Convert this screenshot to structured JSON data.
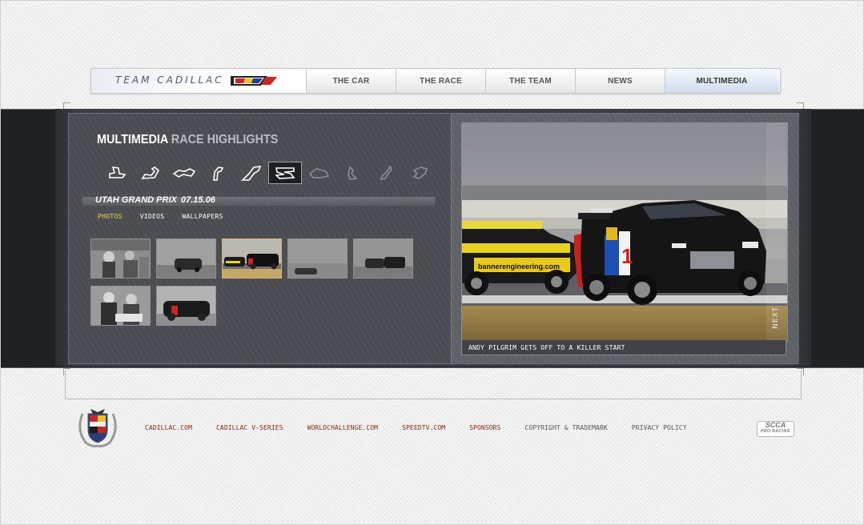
{
  "nav": {
    "brand": "TEAM CADILLAC",
    "brand_logo_icon": "cadillac-crest-icon",
    "items": [
      {
        "label": "THE CAR",
        "active": false
      },
      {
        "label": "THE RACE",
        "active": false
      },
      {
        "label": "THE TEAM",
        "active": false
      },
      {
        "label": "NEWS",
        "active": false
      },
      {
        "label": "MULTIMEDIA",
        "active": true
      }
    ]
  },
  "section": {
    "title": "MULTIMEDIA",
    "subtitle": "RACE HIGHLIGHTS"
  },
  "tracks": {
    "count": 10,
    "selected_index": 5,
    "icon": "race-track-outline-icon"
  },
  "event": {
    "name": "UTAH GRAND PRIX",
    "date": "07.15.06"
  },
  "media_tabs": [
    {
      "label": "PHOTOS",
      "active": true
    },
    {
      "label": "VIDEOS",
      "active": false
    },
    {
      "label": "WALLPAPERS",
      "active": false
    }
  ],
  "thumbnails": {
    "count": 7,
    "selected_index": 2
  },
  "photo": {
    "caption": "ANDY PILGRIM GETS OFF TO A KILLER START",
    "next_label": "NEXT",
    "car_sponsor": "bannerengineering.com",
    "car_number": "1"
  },
  "footer": {
    "links": [
      {
        "label": "CADILLAC.COM",
        "style": "link"
      },
      {
        "label": "CADILLAC V-SERIES",
        "style": "link"
      },
      {
        "label": "WORLDCHALLENGE.COM",
        "style": "link"
      },
      {
        "label": "SPEEDTV.COM",
        "style": "link"
      },
      {
        "label": "SPONSORS",
        "style": "link"
      },
      {
        "label": "COPYRIGHT & TRADEMARK",
        "style": "grey"
      },
      {
        "label": "PRIVACY POLICY",
        "style": "grey"
      }
    ],
    "scca_logo_text": "SCCA",
    "scca_logo_sub": "PRO RACING"
  },
  "colors": {
    "link": "#8a2a0f",
    "active_tab": "#f0d74a",
    "nav_active": "#cfdcee",
    "panel": "#4a4c51"
  }
}
